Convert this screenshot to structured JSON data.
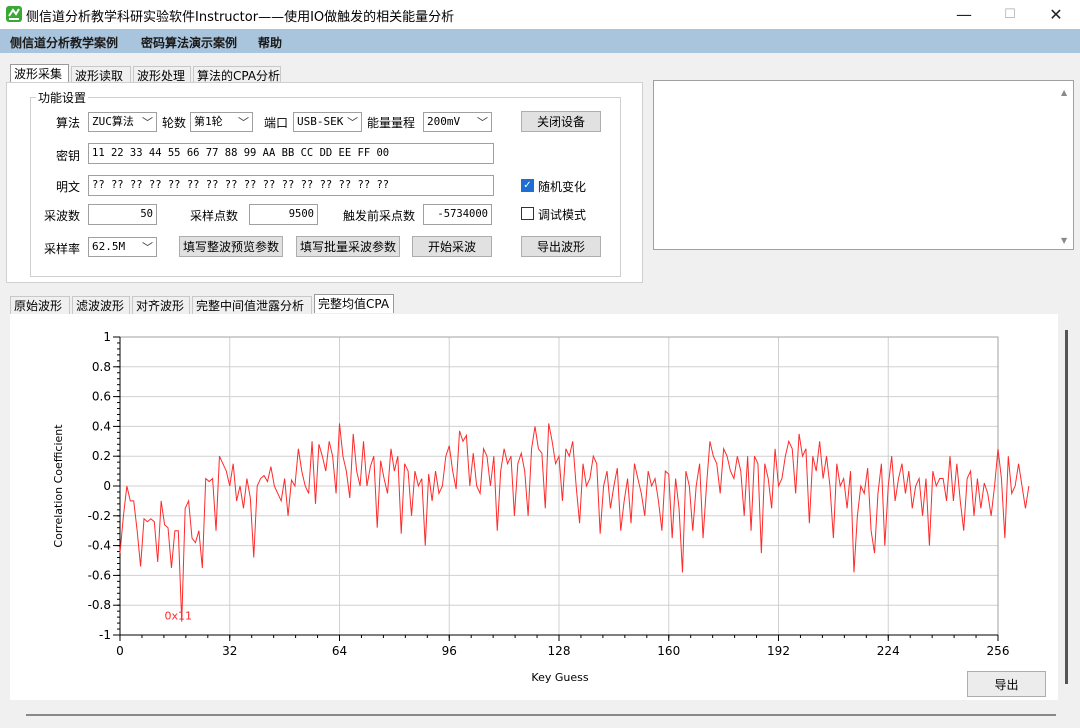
{
  "window": {
    "title": "侧信道分析教学科研实验软件Instructor——使用IO做触发的相关能量分析",
    "minimize": "—",
    "maximize": "☐",
    "close": "✕"
  },
  "menu": [
    "侧信道分析教学案例",
    "密码算法演示案例",
    "帮助"
  ],
  "top_tabs": [
    "波形采集",
    "波形读取",
    "波形处理",
    "算法的CPA分析"
  ],
  "settings": {
    "group_title": "功能设置",
    "algo_label": "算法",
    "algo_value": "ZUC算法",
    "round_label": "轮数",
    "round_value": "第1轮",
    "port_label": "端口",
    "port_value": "USB-SEK",
    "range_label": "能量量程",
    "range_value": "200mV",
    "close_device": "关闭设备",
    "key_label": "密钥",
    "key_value": "11 22 33 44 55 66 77 88 99 AA BB CC DD EE FF 00",
    "plain_label": "明文",
    "plain_value": "?? ?? ?? ?? ?? ?? ?? ?? ?? ?? ?? ?? ?? ?? ?? ??",
    "random_label": "随机变化",
    "random_checked": true,
    "count_label": "采波数",
    "count_value": "50",
    "points_label": "采样点数",
    "points_value": "9500",
    "pretrig_label": "触发前采点数",
    "pretrig_value": "-5734000",
    "debug_label": "调试模式",
    "debug_checked": false,
    "rate_label": "采样率",
    "rate_value": "62.5M",
    "btn_preview": "填写整波预览参数",
    "btn_batch": "填写批量采波参数",
    "btn_start": "开始采波",
    "btn_export_wave": "导出波形"
  },
  "bottom_tabs": [
    "原始波形",
    "滤波波形",
    "对齐波形",
    "完整中间值泄露分析",
    "完整均值CPA"
  ],
  "export_label": "导出",
  "chart_data": {
    "type": "line",
    "xlabel": "Key Guess",
    "ylabel": "Correlation Coefficient",
    "xlim": [
      0,
      256
    ],
    "ylim": [
      -1,
      1
    ],
    "xticks": [
      0,
      32,
      64,
      96,
      128,
      160,
      192,
      224,
      256
    ],
    "yticks": [
      1,
      0.8,
      0.6,
      0.4,
      0.2,
      0,
      -0.2,
      -0.4,
      -0.6,
      -0.8,
      -1
    ],
    "grid": true,
    "color": "#ff2a2a",
    "annotation": {
      "text": "0x11",
      "x": 17,
      "y": -0.91
    },
    "y": [
      -0.45,
      -0.2,
      0.0,
      -0.1,
      -0.1,
      -0.3,
      -0.54,
      -0.22,
      -0.24,
      -0.22,
      -0.24,
      -0.51,
      -0.1,
      -0.26,
      -0.28,
      -0.55,
      -0.3,
      -0.3,
      -0.91,
      -0.15,
      -0.1,
      -0.35,
      -0.38,
      -0.3,
      -0.55,
      0.05,
      0.03,
      0.05,
      -0.3,
      0.2,
      0.15,
      0.1,
      0.0,
      0.15,
      -0.1,
      0.0,
      -0.15,
      0.05,
      -0.08,
      -0.48,
      0.0,
      0.05,
      0.07,
      0.03,
      0.13,
      0.0,
      -0.05,
      -0.1,
      0.05,
      -0.2,
      0.04,
      0.0,
      0.25,
      0.1,
      0.0,
      -0.05,
      0.3,
      -0.12,
      0.28,
      0.2,
      0.1,
      0.3,
      0.2,
      -0.05,
      0.42,
      0.2,
      0.1,
      -0.08,
      0.35,
      0.1,
      0.0,
      0.3,
      0.0,
      0.13,
      0.2,
      -0.28,
      0.17,
      0.05,
      -0.05,
      0.25,
      0.1,
      0.2,
      -0.32,
      0.15,
      0.1,
      -0.2,
      0.1,
      0.0,
      0.05,
      -0.4,
      0.08,
      -0.1,
      0.1,
      -0.05,
      0.0,
      0.2,
      0.27,
      0.1,
      -0.02,
      0.37,
      0.3,
      0.34,
      0.0,
      0.22,
      0.0,
      -0.05,
      0.25,
      0.2,
      0.0,
      0.2,
      -0.3,
      0.1,
      0.25,
      0.15,
      0.2,
      -0.2,
      0.15,
      0.22,
      0.1,
      -0.2,
      0.25,
      0.4,
      0.25,
      0.22,
      -0.15,
      0.42,
      0.3,
      0.15,
      0.2,
      -0.1,
      0.25,
      0.2,
      0.3,
      0.0,
      -0.25,
      0.15,
      0.0,
      0.05,
      0.2,
      0.15,
      -0.32,
      0.0,
      0.1,
      -0.15,
      0.0,
      0.12,
      -0.3,
      -0.1,
      0.05,
      -0.25,
      0.15,
      0.05,
      -0.05,
      -0.2,
      0.1,
      0.0,
      0.05,
      -0.1,
      -0.3,
      0.1,
      0.08,
      -0.35,
      0.05,
      -0.15,
      -0.58,
      0.1,
      0.0,
      -0.3,
      0.0,
      0.15,
      -0.35,
      0.0,
      0.3,
      0.2,
      0.15,
      -0.05,
      0.25,
      0.2,
      0.1,
      0.05,
      0.2,
      0.1,
      -0.2,
      0.2,
      -0.3,
      0.2,
      0.15,
      -0.45,
      0.15,
      0.05,
      -0.15,
      0.25,
      0.0,
      0.05,
      0.2,
      0.3,
      0.25,
      -0.05,
      0.35,
      0.2,
      0.25,
      -0.25,
      0.2,
      0.1,
      0.3,
      0.05,
      0.2,
      0.0,
      -0.35,
      0.15,
      0.0,
      0.05,
      -0.15,
      0.1,
      -0.58,
      -0.2,
      0.0,
      -0.05,
      0.12,
      -0.3,
      -0.45,
      -0.05,
      0.15,
      -0.4,
      0.0,
      0.2,
      -0.1,
      0.05,
      0.15,
      -0.05,
      0.1,
      -0.15,
      0.0,
      0.05,
      -0.2,
      0.05,
      -0.4,
      0.1,
      0.0,
      0.05,
      0.05,
      -0.1,
      0.2,
      -0.1,
      0.15,
      -0.1,
      -0.3,
      0.05,
      0.1,
      -0.2,
      0.05,
      -0.15,
      0.02,
      -0.05,
      -0.2,
      0.0,
      0.25,
      0.05,
      -0.35,
      0.2,
      -0.05,
      0.0,
      0.15,
      0.0,
      -0.15,
      0.0
    ]
  }
}
